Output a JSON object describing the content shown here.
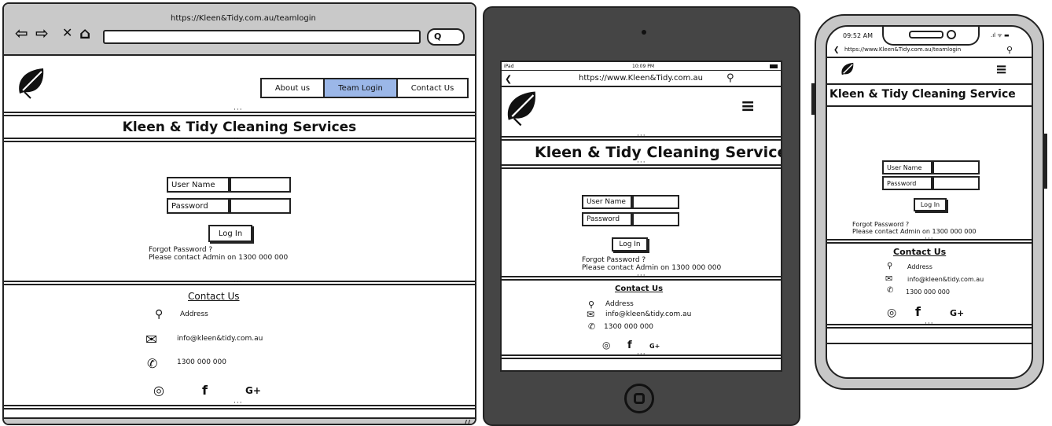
{
  "desktop": {
    "url": "https://Kleen&Tidy.com.au/teamlogin",
    "nav": {
      "back": "⇦",
      "forward": "⇨",
      "stop": "✕",
      "home": "⌂",
      "search": "Q"
    },
    "menu": [
      "About us",
      "Team Login",
      "Contact Us"
    ],
    "title": "Kleen & Tidy Cleaning Services",
    "form": {
      "username_label": "User Name",
      "password_label": "Password",
      "login_button": "Log In",
      "forgot": "Forgot Password ?",
      "contact_admin": "Please contact Admin on 1300 000 000"
    },
    "contact": {
      "heading": "Contact Us",
      "address": "Address",
      "email": "info@kleen&tidy.com.au",
      "phone": "1300 000 000"
    }
  },
  "tablet": {
    "status_left": "iPad",
    "status_time": "10:09 PM",
    "url": "https://www.Kleen&Tidy.com.au",
    "title": "Kleen & Tidy Cleaning Services",
    "form": {
      "username_label": "User Name",
      "password_label": "Password",
      "login_button": "Log In",
      "forgot": "Forgot Password ?",
      "contact_admin": "Please contact Admin on 1300 000 000"
    },
    "contact": {
      "heading": "Contact Us",
      "address": "Address",
      "email": "info@kleen&tidy.com.au",
      "phone": "1300 000 000"
    }
  },
  "phone": {
    "status_time": "09:52 AM",
    "url": "https://www.Kleen&Tidy.com.au/teamlogin",
    "title": "Kleen & Tidy Cleaning Service",
    "form": {
      "username_label": "User Name",
      "password_label": "Password",
      "login_button": "Log In",
      "forgot": "Forgot Password ?",
      "contact_admin": "Please contact Admin on 1300 000 000"
    },
    "contact": {
      "heading": "Contact Us",
      "address": "Address",
      "email": "info@kleen&tidy.com.au",
      "phone": "1300 000 000"
    }
  },
  "social": {
    "instagram": "◎",
    "facebook": "f",
    "googleplus": "G+"
  },
  "icons": {
    "hamburger": "≡",
    "pin": "⚲",
    "mail": "✉",
    "phone": "✆"
  }
}
